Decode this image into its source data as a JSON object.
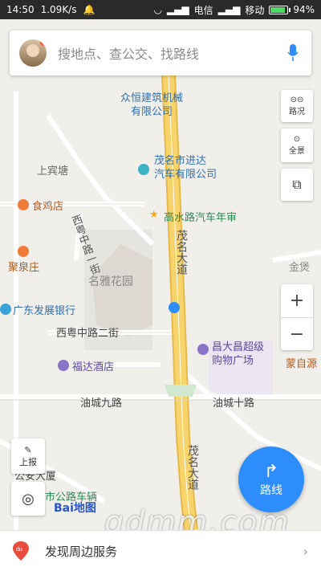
{
  "status": {
    "time": "14:50",
    "speed": "1.09K/s",
    "carrier1": "电信",
    "carrier2": "移动",
    "battery_text": "94%",
    "battery_level": 0.94
  },
  "search": {
    "placeholder": "搜地点、查公交、找路线"
  },
  "controls": {
    "traffic_label": "路况",
    "panorama_label": "全景",
    "zoom_in": "+",
    "zoom_out": "−",
    "report_label": "上报",
    "route_label": "路线"
  },
  "map_labels": {
    "poi_jixie": "众恒建筑机械\n有限公司",
    "poi_jinda": "茂名市进达\n汽车有限公司",
    "shangbintang": "上宾塘",
    "shijidian": "食鸡店",
    "gaoshui": "高水路汽车年审",
    "xiyue_1": "西粤中路一街",
    "jujuanzhuang": "聚泉庄",
    "mingya": "名雅花园",
    "maoming_dadao_1": "茂名大道",
    "jinbang": "金煲",
    "guangdong_bank": "广东发展银行",
    "xiyue_2": "西粤中路二街",
    "changdachang": "昌大昌超级\n购物广场",
    "fuda": "福达酒店",
    "mengziyuan": "蒙自源",
    "youcheng_9": "油城九路",
    "youcheng_10": "油城十路",
    "maoming_dadao_2": "茂名大道",
    "gongan": "公安大厦",
    "gonglu": "市公路车辆",
    "baidu_map": "Bai地图",
    "watermark": "gdmm.com"
  },
  "bottom": {
    "service_label": "发现周边服务"
  },
  "colors": {
    "accent": "#2e8dfd",
    "road_main": "#f7d36b",
    "status_bg": "#2a2a2a"
  }
}
